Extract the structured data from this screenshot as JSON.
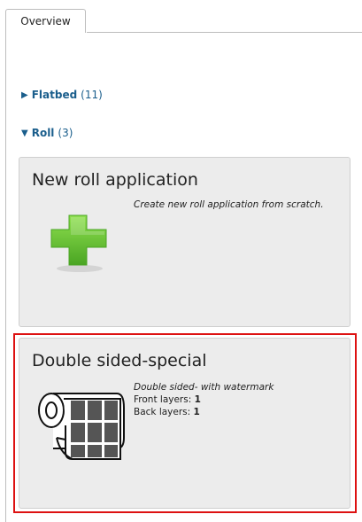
{
  "tabs": {
    "overview_label": "Overview"
  },
  "groups": [
    {
      "name": "Flatbed",
      "count": "(11)",
      "expanded": false
    },
    {
      "name": "Roll",
      "count": "(3)",
      "expanded": true
    }
  ],
  "cards": [
    {
      "title": "New roll application",
      "description": "Create new roll application from scratch.",
      "icon": "plus-icon"
    },
    {
      "title": "Double sided-special",
      "description": "Double sided- with watermark",
      "front_layers_label": "Front layers:",
      "front_layers_value": "1",
      "back_layers_label": "Back layers:",
      "back_layers_value": "1",
      "icon": "roll-icon",
      "selected": true
    }
  ],
  "colors": {
    "link": "#1a5e8c",
    "selection": "#dd1111",
    "plus": "#6cc43a"
  }
}
